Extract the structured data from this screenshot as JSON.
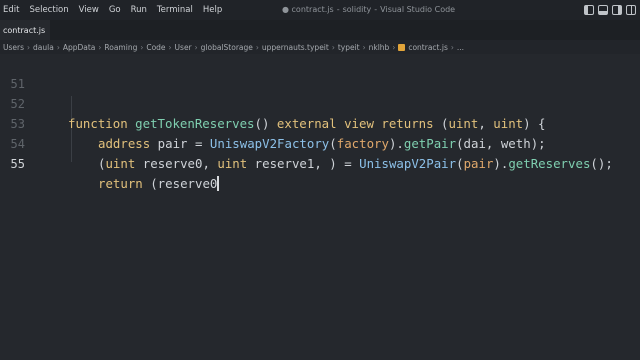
{
  "menu": [
    "Edit",
    "Selection",
    "View",
    "Go",
    "Run",
    "Terminal",
    "Help"
  ],
  "window_title": {
    "file": "contract.js",
    "folder": "solidity",
    "app": "Visual Studio Code"
  },
  "tab": {
    "label": "contract.js"
  },
  "breadcrumb": [
    "Users",
    "daula",
    "AppData",
    "Roaming",
    "Code",
    "User",
    "globalStorage",
    "uppernauts.typeit",
    "typeit",
    "nklhb",
    "contract.js"
  ],
  "editor": {
    "line_numbers": [
      "51",
      "52",
      "53",
      "54",
      "55"
    ],
    "active_line": "55",
    "lines": {
      "l52": [
        {
          "t": "function",
          "c": "kw"
        },
        {
          "t": " ",
          "c": "pl"
        },
        {
          "t": "getTokenReserves",
          "c": "fn"
        },
        {
          "t": "() ",
          "c": "pl"
        },
        {
          "t": "external",
          "c": "kw"
        },
        {
          "t": " ",
          "c": "pl"
        },
        {
          "t": "view",
          "c": "kw"
        },
        {
          "t": " ",
          "c": "pl"
        },
        {
          "t": "returns",
          "c": "kw"
        },
        {
          "t": " (",
          "c": "pl"
        },
        {
          "t": "uint",
          "c": "kw"
        },
        {
          "t": ", ",
          "c": "pl"
        },
        {
          "t": "uint",
          "c": "kw"
        },
        {
          "t": ") {",
          "c": "pl"
        }
      ],
      "l53": [
        {
          "t": "address",
          "c": "kw"
        },
        {
          "t": " pair = ",
          "c": "pl"
        },
        {
          "t": "UniswapV2Factory",
          "c": "ty"
        },
        {
          "t": "(",
          "c": "pl"
        },
        {
          "t": "factory",
          "c": "pa"
        },
        {
          "t": ").",
          "c": "pl"
        },
        {
          "t": "getPair",
          "c": "fn"
        },
        {
          "t": "(dai, weth);",
          "c": "pl"
        }
      ],
      "l54": [
        {
          "t": "(",
          "c": "pl"
        },
        {
          "t": "uint",
          "c": "kw"
        },
        {
          "t": " reserve0, ",
          "c": "pl"
        },
        {
          "t": "uint",
          "c": "kw"
        },
        {
          "t": " reserve1, ) = ",
          "c": "pl"
        },
        {
          "t": "UniswapV2Pair",
          "c": "ty"
        },
        {
          "t": "(",
          "c": "pl"
        },
        {
          "t": "pair",
          "c": "pa"
        },
        {
          "t": ").",
          "c": "pl"
        },
        {
          "t": "getReserves",
          "c": "fn"
        },
        {
          "t": "();",
          "c": "pl"
        }
      ],
      "l55": [
        {
          "t": "return",
          "c": "kw"
        },
        {
          "t": " (reserve0",
          "c": "pl"
        }
      ]
    }
  },
  "colors": {
    "background": "#25282d",
    "keyword": "#e2c17c",
    "function": "#7fcfb0",
    "type": "#8cc0e8"
  },
  "icons": [
    "file-js-icon",
    "unsaved-dot-icon",
    "layout-toggle-icons"
  ]
}
